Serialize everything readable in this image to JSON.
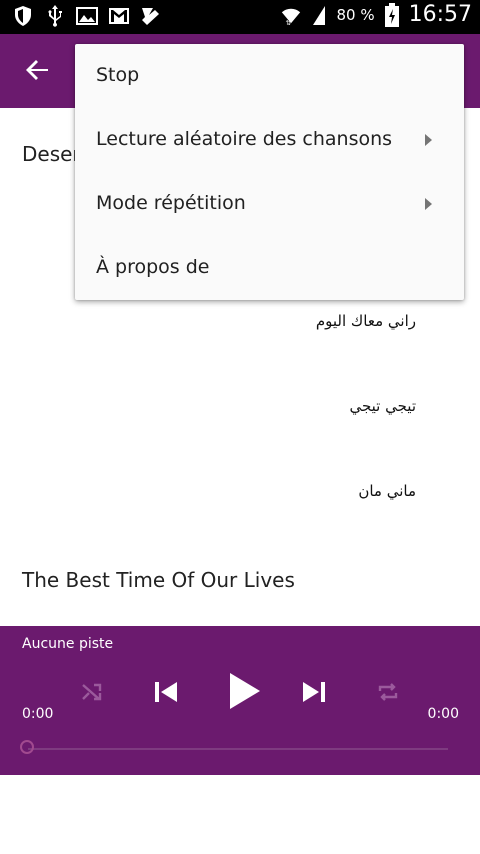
{
  "status_bar": {
    "icons": [
      "shield-icon",
      "usb-icon",
      "image-icon",
      "gmail-icon",
      "checkmark-icon"
    ],
    "battery_percent": "80 %",
    "time": "16:57"
  },
  "app_bar": {
    "back_icon": "arrow-left-icon"
  },
  "content": {
    "section_1_title": "Deser",
    "songs": [
      "راني معاك اليوم",
      "تيجي تيجي",
      "ماني مان"
    ],
    "section_2_title": "The Best Time Of Our Lives"
  },
  "menu": {
    "items": [
      {
        "label": "Stop",
        "has_submenu": false
      },
      {
        "label": "Lecture aléatoire des chansons",
        "has_submenu": true
      },
      {
        "label": "Mode répétition",
        "has_submenu": true
      },
      {
        "label": "À propos de",
        "has_submenu": false
      }
    ]
  },
  "player": {
    "track_name": "Aucune piste",
    "time_elapsed": "0:00",
    "time_total": "0:00",
    "progress": 0,
    "controls": [
      "shuffle-icon",
      "skip-previous-icon",
      "play-icon",
      "skip-next-icon",
      "repeat-icon"
    ]
  },
  "colors": {
    "primary": "#6b1a6e",
    "status_bar": "#000000",
    "menu_background": "#fafafa"
  }
}
